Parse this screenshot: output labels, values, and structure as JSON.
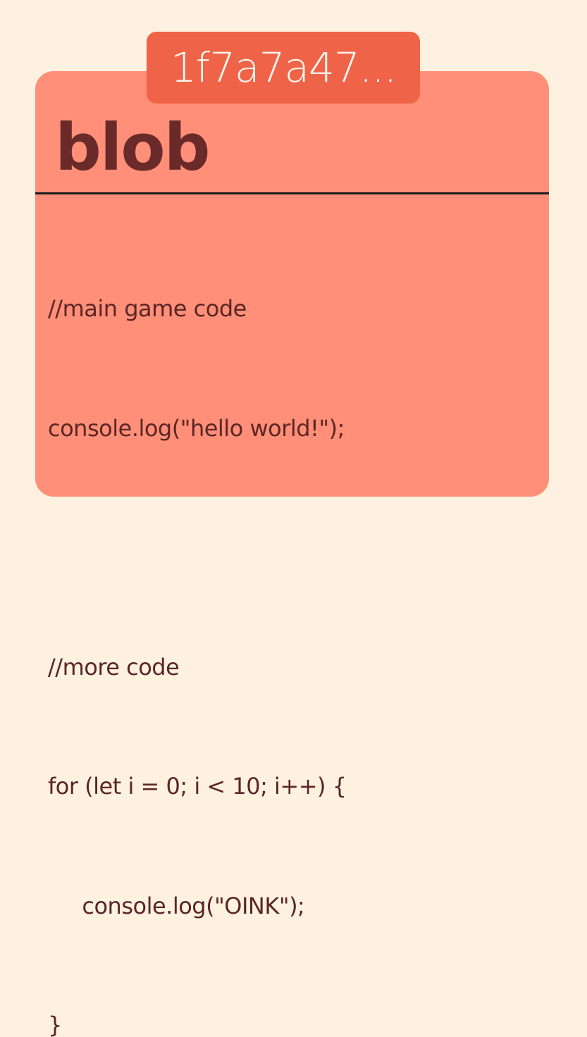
{
  "object": {
    "hash": "1f7a7a47...",
    "type": "blob",
    "content_lines": [
      "//main game code",
      "console.log(\"hello world!\");",
      "",
      "//more code",
      "for (let i = 0; i < 10; i++) {",
      "     console.log(\"OINK\");",
      "}"
    ]
  },
  "colors": {
    "background": "#fef1e0",
    "card": "#ff8f78",
    "hash_tag": "#ef6448",
    "type_text": "#6b2a2a",
    "code_text": "#5a2626",
    "divider": "#1a1a1a"
  }
}
